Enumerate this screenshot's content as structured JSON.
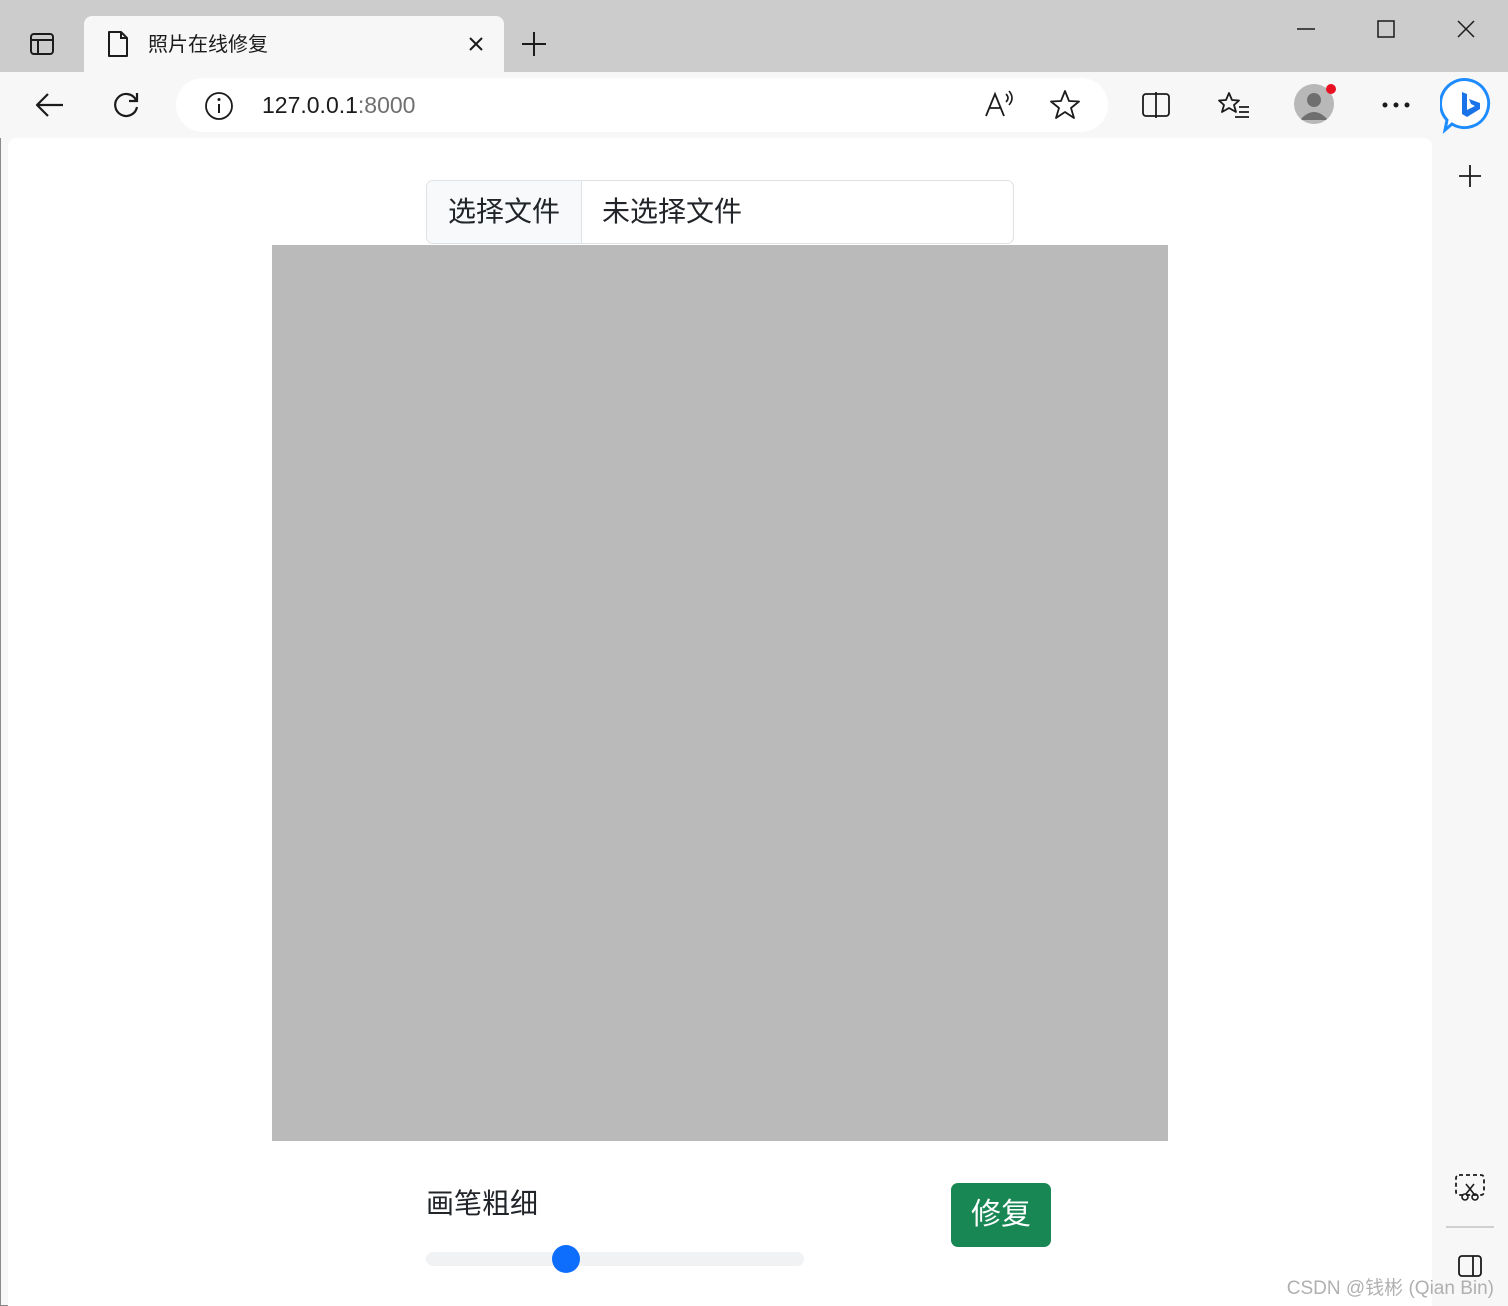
{
  "browser": {
    "tab": {
      "title": "照片在线修复",
      "icon": "page-icon",
      "close_icon": "close-icon"
    },
    "new_tab_icon": "plus-icon",
    "window_controls": [
      "minimize-icon",
      "maximize-icon",
      "close-icon"
    ],
    "address": {
      "host": "127.0.0.1",
      "port": ":8000",
      "info_icon": "info-icon"
    },
    "toolbar_icons": [
      "back-icon",
      "refresh-icon",
      "read-aloud-icon",
      "favorite-star-icon",
      "split-screen-icon",
      "favorites-list-icon",
      "profile-avatar",
      "more-icon",
      "bing-copilot-icon"
    ],
    "side_panel_icons": [
      "add-icon",
      "screenshot-icon",
      "hide-sidebar-icon"
    ]
  },
  "page": {
    "file_input": {
      "button_label": "选择文件",
      "status": "未选择文件"
    },
    "canvas_color": "#bababa",
    "brush": {
      "label": "画笔粗细",
      "value_fraction": 0.37
    },
    "repair_button": "修复"
  },
  "watermark": "CSDN @钱彬 (Qian Bin)",
  "colors": {
    "primary": "#0d6efd",
    "success": "#198754",
    "chrome": "#cccccc"
  }
}
